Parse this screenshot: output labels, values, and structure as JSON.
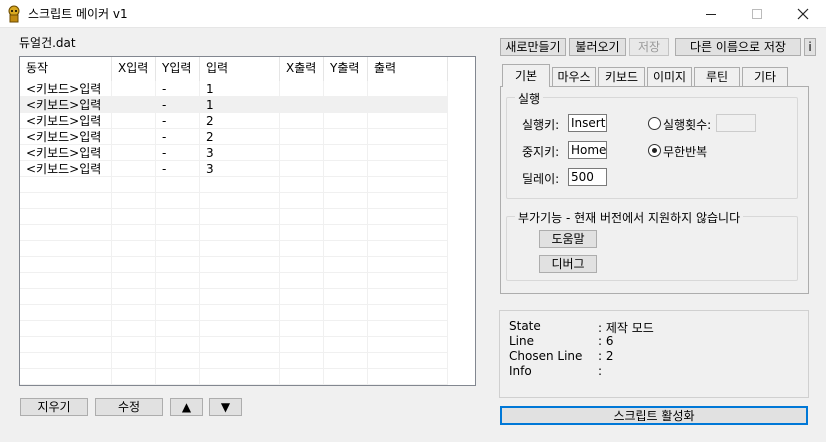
{
  "window": {
    "title": "스크립트 메이커 v1"
  },
  "file": {
    "name": "듀얼건.dat"
  },
  "list": {
    "columns": [
      "동작",
      "X입력",
      "Y입력",
      "입력",
      "X출력",
      "Y출력",
      "출력"
    ],
    "rows": [
      [
        "<키보드>입력",
        "",
        "-",
        "1",
        "",
        "",
        ""
      ],
      [
        "<키보드>입력",
        "",
        "-",
        "1",
        "",
        "",
        ""
      ],
      [
        "<키보드>입력",
        "",
        "-",
        "2",
        "",
        "",
        ""
      ],
      [
        "<키보드>입력",
        "",
        "-",
        "2",
        "",
        "",
        ""
      ],
      [
        "<키보드>입력",
        "",
        "-",
        "3",
        "",
        "",
        ""
      ],
      [
        "<키보드>입력",
        "",
        "-",
        "3",
        "",
        "",
        ""
      ]
    ],
    "selected_row": 2
  },
  "list_buttons": {
    "erase": "지우기",
    "edit": "수정",
    "up": "▲",
    "down": "▼"
  },
  "toolbar": {
    "new": "새로만들기",
    "load": "불러오기",
    "save": "저장",
    "save_as": "다른 이름으로 저장",
    "info": "i"
  },
  "tabs": [
    "기본",
    "마우스",
    "키보드",
    "이미지",
    "루틴",
    "기타"
  ],
  "run_group": {
    "title": "실행",
    "run_key_label": "실행키:",
    "run_key_value": "Insert",
    "stop_key_label": "중지키:",
    "stop_key_value": "Home",
    "delay_label": "딜레이:",
    "delay_value": "500",
    "run_count_label": "실행횟수:",
    "run_count_value": "",
    "infinite_label": "무한반복"
  },
  "extra_group": {
    "title": "부가기능 - 현재 버전에서 지원하지 않습니다",
    "help": "도움말",
    "debug": "디버그"
  },
  "status": {
    "state_label": "State",
    "state_value": ": 제작 모드",
    "line_label": "Line",
    "line_value": ": 6",
    "chosen_label": "Chosen Line",
    "chosen_value": ": 2",
    "info_label": "Info",
    "info_value": ":"
  },
  "activate_button": "스크립트 활성화"
}
